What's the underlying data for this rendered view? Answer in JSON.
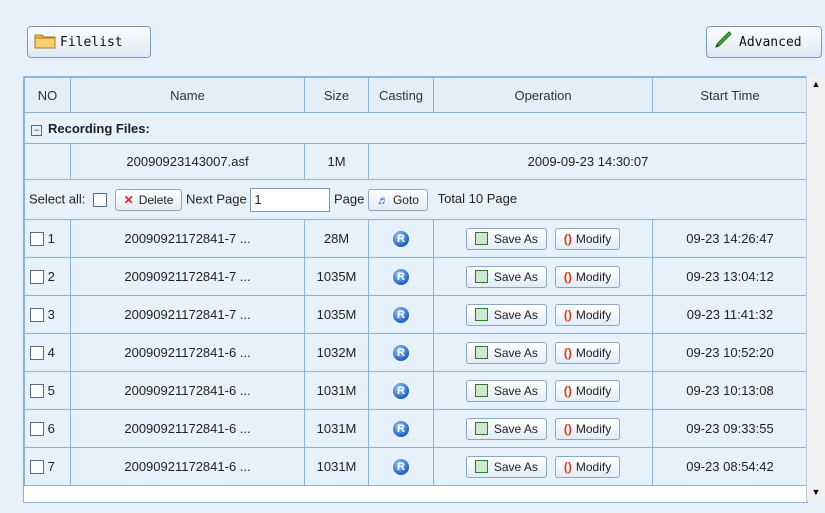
{
  "toolbar": {
    "filelist_label": "Filelist",
    "advanced_label": "Advanced",
    "filelist_icon": "folder-icon",
    "advanced_icon": "pencil-icon"
  },
  "table": {
    "headers": [
      "NO",
      "Name",
      "Size",
      "Casting",
      "Operation",
      "Start Time"
    ],
    "section_title": "Recording Files:",
    "recording": {
      "name": "20090923143007.asf",
      "size": "1M",
      "datetime": "2009-09-23 14:30:07"
    },
    "paging": {
      "select_all_label": "Select all:",
      "delete_label": "Delete",
      "next_page_label": "Next Page",
      "page_value": "1",
      "page_label": "Page",
      "goto_label": "Goto",
      "total_label": "Total 10  Page"
    },
    "rows": [
      {
        "no": "1",
        "name": "20090921172841-7 ...",
        "size": "28M",
        "save": "Save As",
        "modify": "Modify",
        "start": "09-23 14:26:47"
      },
      {
        "no": "2",
        "name": "20090921172841-7 ...",
        "size": "1035M",
        "save": "Save As",
        "modify": "Modify",
        "start": "09-23 13:04:12"
      },
      {
        "no": "3",
        "name": "20090921172841-7 ...",
        "size": "1035M",
        "save": "Save As",
        "modify": "Modify",
        "start": "09-23 11:41:32"
      },
      {
        "no": "4",
        "name": "20090921172841-6 ...",
        "size": "1032M",
        "save": "Save As",
        "modify": "Modify",
        "start": "09-23 10:52:20"
      },
      {
        "no": "5",
        "name": "20090921172841-6 ...",
        "size": "1031M",
        "save": "Save As",
        "modify": "Modify",
        "start": "09-23 10:13:08"
      },
      {
        "no": "6",
        "name": "20090921172841-6 ...",
        "size": "1031M",
        "save": "Save As",
        "modify": "Modify",
        "start": "09-23 09:33:55"
      },
      {
        "no": "7",
        "name": "20090921172841-6 ...",
        "size": "1031M",
        "save": "Save As",
        "modify": "Modify",
        "start": "09-23 08:54:42"
      }
    ]
  }
}
